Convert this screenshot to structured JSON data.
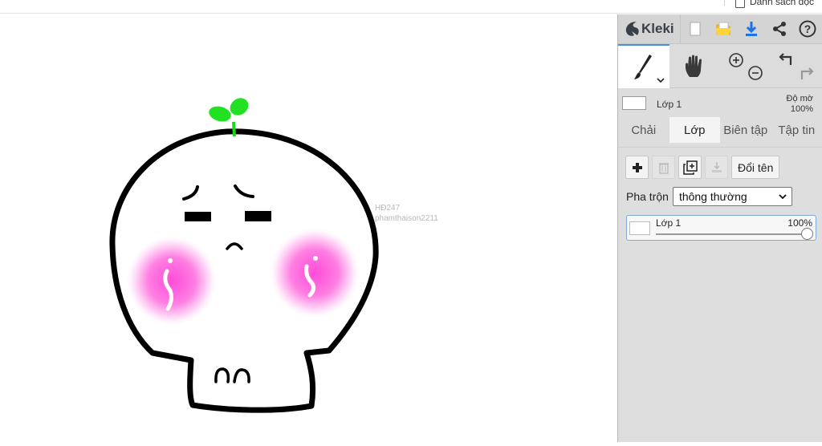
{
  "browser": {
    "reading_list_label": "Danh sách đọc"
  },
  "canvas": {
    "watermark_line1": "HĐ247",
    "watermark_line2": "phamthaison2211"
  },
  "app": {
    "logo_text": "Kleki"
  },
  "toolbar": {
    "icons": [
      "new-file-icon",
      "open-folder-icon",
      "download-icon",
      "share-icon",
      "help-icon"
    ],
    "accent": "#1a73e8"
  },
  "tools": [
    "brush-tool",
    "hand-tool",
    "zoom-tool",
    "undo-redo-tool"
  ],
  "layer_strip": {
    "name": "Lớp 1",
    "opacity_label": "Độ mờ",
    "opacity_value": "100%"
  },
  "tabs": [
    {
      "label": "Chải"
    },
    {
      "label": "Lớp",
      "active": true
    },
    {
      "label": "Biên tập"
    },
    {
      "label": "Tập tin"
    }
  ],
  "layers_panel": {
    "rename_label": "Đổi tên",
    "blend_label": "Pha trộn",
    "blend_value": "thông thường",
    "layer": {
      "name": "Lớp 1",
      "opacity": "100%",
      "opacity_fraction": 1.0
    }
  },
  "colors": {
    "active_tab_border": "#4a90e2",
    "leaf": "#1ee61e",
    "blush": "#ff66dd"
  }
}
